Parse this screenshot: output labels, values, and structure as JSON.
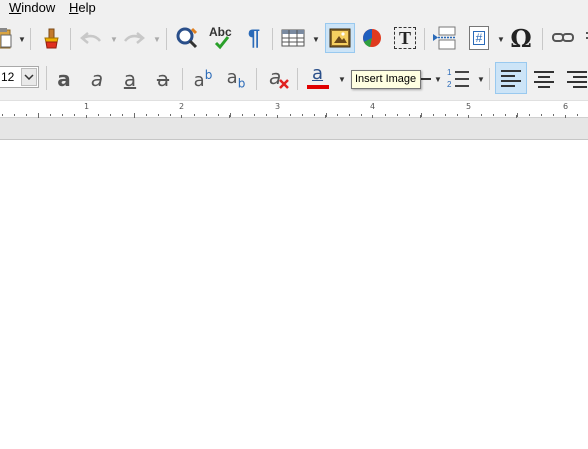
{
  "menu": {
    "window": "Window",
    "window_mnemonic": "W",
    "window_rest": "indow",
    "help": "Help",
    "help_mnemonic": "H",
    "help_rest": "elp"
  },
  "toolbar": {
    "spelling_label": "Abc",
    "special_char_glyph": "Ω",
    "textbox_glyph": "T",
    "field_glyph": "#",
    "formatting_marks_glyph": "¶",
    "font_size_value": "12",
    "bold_glyph": "a",
    "italic_glyph": "a",
    "underline_glyph": "a",
    "strike_glyph": "a",
    "super_glyph": "a",
    "super_exp": "b",
    "sub_glyph": "a",
    "sub_exp": "b",
    "clear_glyph": "a",
    "font_color_glyph": "a",
    "list_num_1": "1",
    "list_num_2": "2"
  },
  "tooltip": {
    "text": "Insert Image"
  },
  "ruler": {
    "numbers": [
      "1",
      "2",
      "3",
      "4",
      "5",
      "6"
    ]
  },
  "colors": {
    "accent_active": "#cce4f7",
    "font_color_red": "#e00000",
    "chart_blue": "#1e5fbf",
    "chart_red": "#e03a1e"
  }
}
